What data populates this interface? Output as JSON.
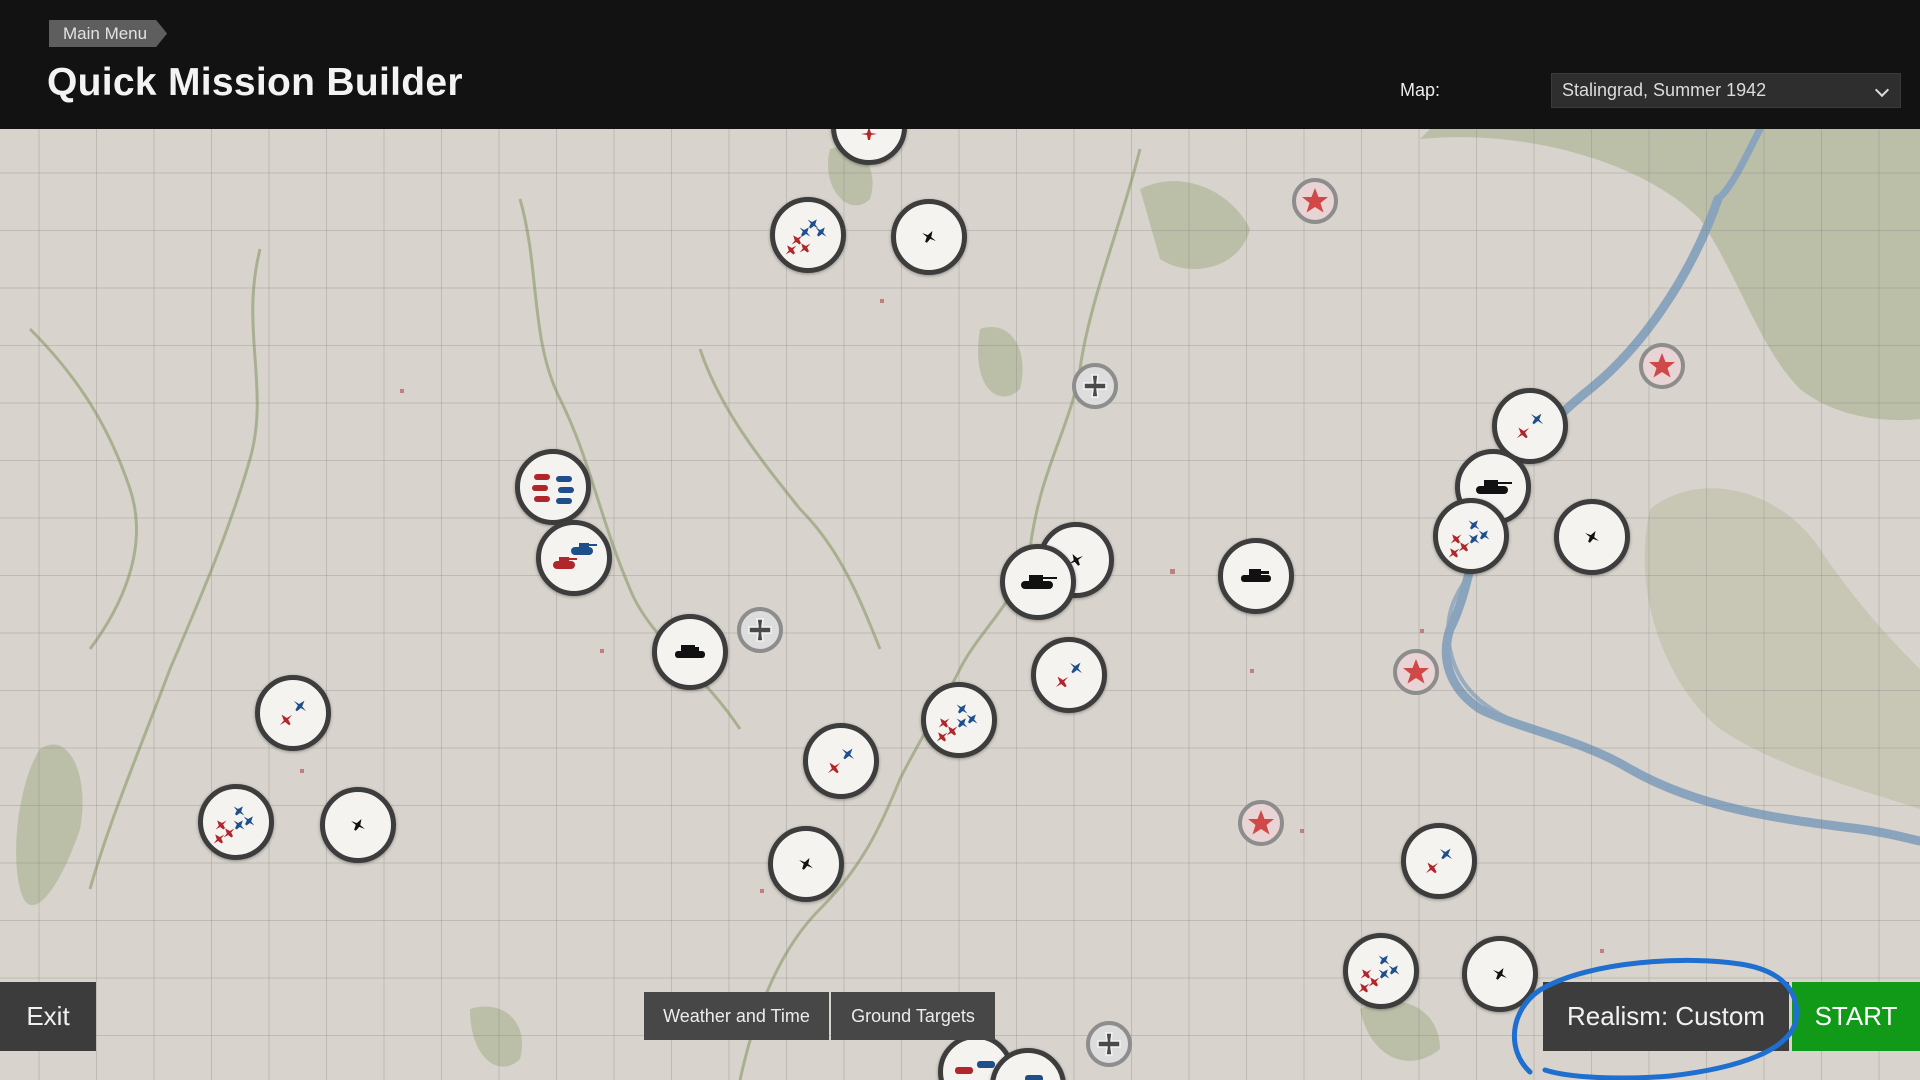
{
  "header": {
    "breadcrumb": "Main Menu",
    "title": "Quick Mission Builder",
    "map_label": "Map:",
    "map_selected": "Stalingrad, Summer 1942"
  },
  "bottom_bar": {
    "exit_label": "Exit",
    "tabs": [
      {
        "label": "Weather and Time"
      },
      {
        "label": "Ground Targets"
      }
    ],
    "realism_label": "Realism: Custom",
    "start_label": "START"
  },
  "colors": {
    "allied_red": "#b0262b",
    "axis_blue": "#1f4f8a",
    "start_green": "#119a17",
    "annotation_blue": "#1e6fd0"
  },
  "map_markers": [
    {
      "kind": "flight-mixed"
    },
    {
      "kind": "waypoint-single"
    },
    {
      "kind": "tank-group-mixed"
    },
    {
      "kind": "tank-pair-mixed"
    },
    {
      "kind": "vehicle-black"
    },
    {
      "kind": "waypoint-single"
    },
    {
      "kind": "tank-black"
    },
    {
      "kind": "flight-pair"
    },
    {
      "kind": "vehicle-black"
    },
    {
      "kind": "flight-pair"
    },
    {
      "kind": "flight-mixed"
    },
    {
      "kind": "flight-pair"
    },
    {
      "kind": "waypoint-single"
    },
    {
      "kind": "flight-pair"
    },
    {
      "kind": "flight-mixed"
    },
    {
      "kind": "waypoint-single"
    },
    {
      "kind": "flight-pair"
    },
    {
      "kind": "tank-black"
    },
    {
      "kind": "flight-mixed"
    },
    {
      "kind": "waypoint-single"
    },
    {
      "kind": "flight-pair"
    },
    {
      "kind": "flight-mixed"
    },
    {
      "kind": "waypoint-single"
    },
    {
      "kind": "tank-group-mixed"
    }
  ],
  "airfields": [
    {
      "icon": "red-star-icon"
    },
    {
      "icon": "red-star-icon"
    },
    {
      "icon": "red-star-icon"
    },
    {
      "icon": "red-star-icon"
    }
  ],
  "depots": [
    {
      "icon": "iron-cross-icon"
    },
    {
      "icon": "iron-cross-icon"
    },
    {
      "icon": "iron-cross-icon"
    }
  ]
}
